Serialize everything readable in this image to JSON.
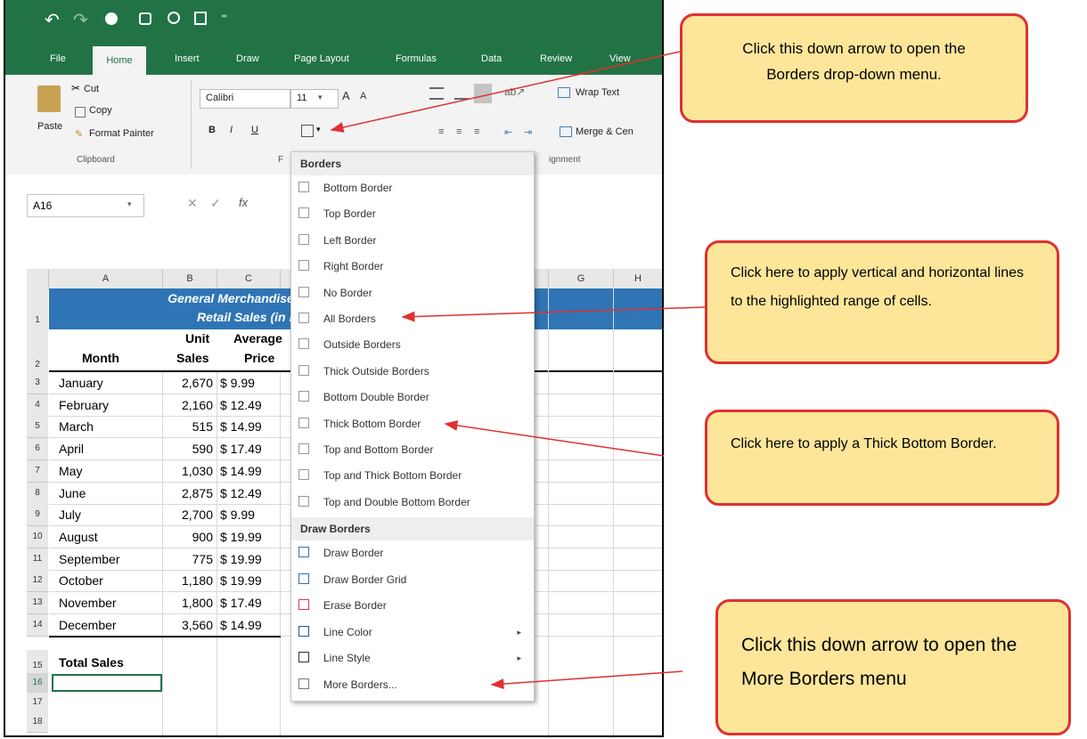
{
  "qat": {
    "undo": "↶",
    "redo": "↷",
    "save": "💾"
  },
  "tabs": [
    "File",
    "Home",
    "Insert",
    "Draw",
    "Page Layout",
    "Formulas",
    "Data",
    "Review",
    "View"
  ],
  "clipboard": {
    "cut": "Cut",
    "copy": "Copy",
    "paste": "Paste",
    "format_painter": "Format Painter",
    "group": "Clipboard"
  },
  "font": {
    "name": "Calibri",
    "size": "11",
    "bold": "B",
    "italic": "I",
    "underline": "U",
    "group": "F"
  },
  "alignment": {
    "wrap": "Wrap Text",
    "merge": "Merge & Cen",
    "group": "ignment"
  },
  "formula_bar": {
    "name_box": "A16",
    "fx": "fx"
  },
  "columns": [
    "A",
    "B",
    "C",
    "G",
    "H"
  ],
  "sheet": {
    "title1": "General Merchandise",
    "title2": "Retail Sales (in millio",
    "headers": {
      "month": "Month",
      "unit": "Unit",
      "sales": "Sales",
      "avg": "Average",
      "price": "Price"
    },
    "rows": [
      {
        "n": "3",
        "month": "January",
        "units": "2,670",
        "price": "$ 9.99"
      },
      {
        "n": "4",
        "month": "February",
        "units": "2,160",
        "price": "$ 12.49"
      },
      {
        "n": "5",
        "month": "March",
        "units": "515",
        "price": "$ 14.99"
      },
      {
        "n": "6",
        "month": "April",
        "units": "590",
        "price": "$ 17.49"
      },
      {
        "n": "7",
        "month": "May",
        "units": "1,030",
        "price": "$ 14.99"
      },
      {
        "n": "8",
        "month": "June",
        "units": "2,875",
        "price": "$ 12.49"
      },
      {
        "n": "9",
        "month": "July",
        "units": "2,700",
        "price": "$ 9.99"
      },
      {
        "n": "10",
        "month": "August",
        "units": "900",
        "price": "$ 19.99"
      },
      {
        "n": "11",
        "month": "September",
        "units": "775",
        "price": "$ 19.99"
      },
      {
        "n": "12",
        "month": "October",
        "units": "1,180",
        "price": "$ 19.99"
      },
      {
        "n": "13",
        "month": "November",
        "units": "1,800",
        "price": "$ 17.49"
      },
      {
        "n": "14",
        "month": "December",
        "units": "3,560",
        "price": "$ 14.99"
      }
    ],
    "total_label": "Total Sales",
    "rownums": {
      "r1": "1",
      "r2": "2",
      "r15": "15",
      "r16": "16",
      "r17": "17",
      "r18": "18"
    }
  },
  "menu": {
    "header1": "Borders",
    "items1": [
      "Bottom Border",
      "Top Border",
      "Left Border",
      "Right Border",
      "No Border",
      "All Borders",
      "Outside Borders",
      "Thick Outside Borders",
      "Bottom Double Border",
      "Thick Bottom Border",
      "Top and Bottom Border",
      "Top and Thick Bottom Border",
      "Top and Double Bottom Border"
    ],
    "header2": "Draw Borders",
    "items2": [
      "Draw Border",
      "Draw Border Grid",
      "Erase Border",
      "Line Color",
      "Line Style",
      "More Borders..."
    ],
    "submenu_arrow": "▸"
  },
  "callouts": {
    "c1": "Click this down arrow to open the Borders drop-down menu.",
    "c2": "Click here to apply vertical and horizontal lines to the highlighted range of cells.",
    "c3": "Click here to apply a Thick Bottom Border.",
    "c4": "Click this down arrow to open the More Borders menu"
  },
  "colors": {
    "excel_green": "#217346",
    "title_blue": "#2f75b5",
    "callout_fill": "#fde69a",
    "callout_border": "#e03030",
    "arrow": "#e03030"
  }
}
